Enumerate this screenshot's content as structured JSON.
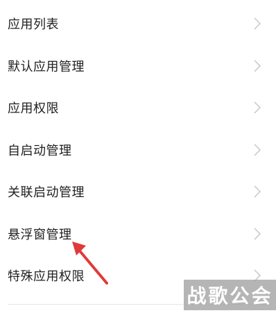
{
  "menu": {
    "items": [
      {
        "label": "应用列表"
      },
      {
        "label": "默认应用管理"
      },
      {
        "label": "应用权限"
      },
      {
        "label": "自启动管理"
      },
      {
        "label": "关联启动管理"
      },
      {
        "label": "悬浮窗管理"
      },
      {
        "label": "特殊应用权限"
      }
    ],
    "chevron_icon": "chevron-right-icon"
  },
  "annotation": {
    "arrow_color": "#e03a3a",
    "points_to": "悬浮窗管理"
  },
  "watermark": {
    "text": "战歌公会"
  }
}
